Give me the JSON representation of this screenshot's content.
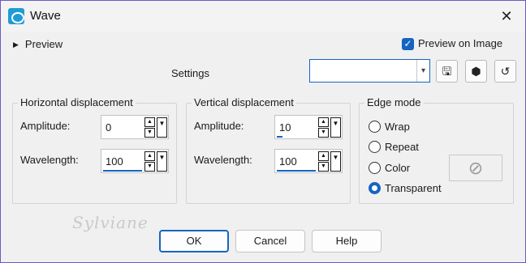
{
  "window": {
    "title": "Wave",
    "close_glyph": "✕",
    "icon": "wave-app-icon"
  },
  "preview": {
    "label": "Preview",
    "preview_on_image_label": "Preview on Image",
    "preview_on_image_checked": true
  },
  "settings": {
    "label": "Settings",
    "value": "",
    "buttons": [
      "save-icon",
      "presets-icon",
      "reset-icon"
    ]
  },
  "horizontal": {
    "title": "Horizontal displacement",
    "amplitude_label": "Amplitude:",
    "amplitude_value": "0",
    "wavelength_label": "Wavelength:",
    "wavelength_value": "100"
  },
  "vertical": {
    "title": "Vertical displacement",
    "amplitude_label": "Amplitude:",
    "amplitude_value": "10",
    "wavelength_label": "Wavelength:",
    "wavelength_value": "100"
  },
  "edge_mode": {
    "title": "Edge mode",
    "options": [
      "Wrap",
      "Repeat",
      "Color",
      "Transparent"
    ],
    "selected": "Transparent"
  },
  "buttons": {
    "ok": "OK",
    "cancel": "Cancel",
    "help": "Help"
  },
  "watermark": "Sylviane",
  "colors": {
    "accent": "#1565c0",
    "window_border": "#6b58c8",
    "background": "#f0f0f0"
  }
}
